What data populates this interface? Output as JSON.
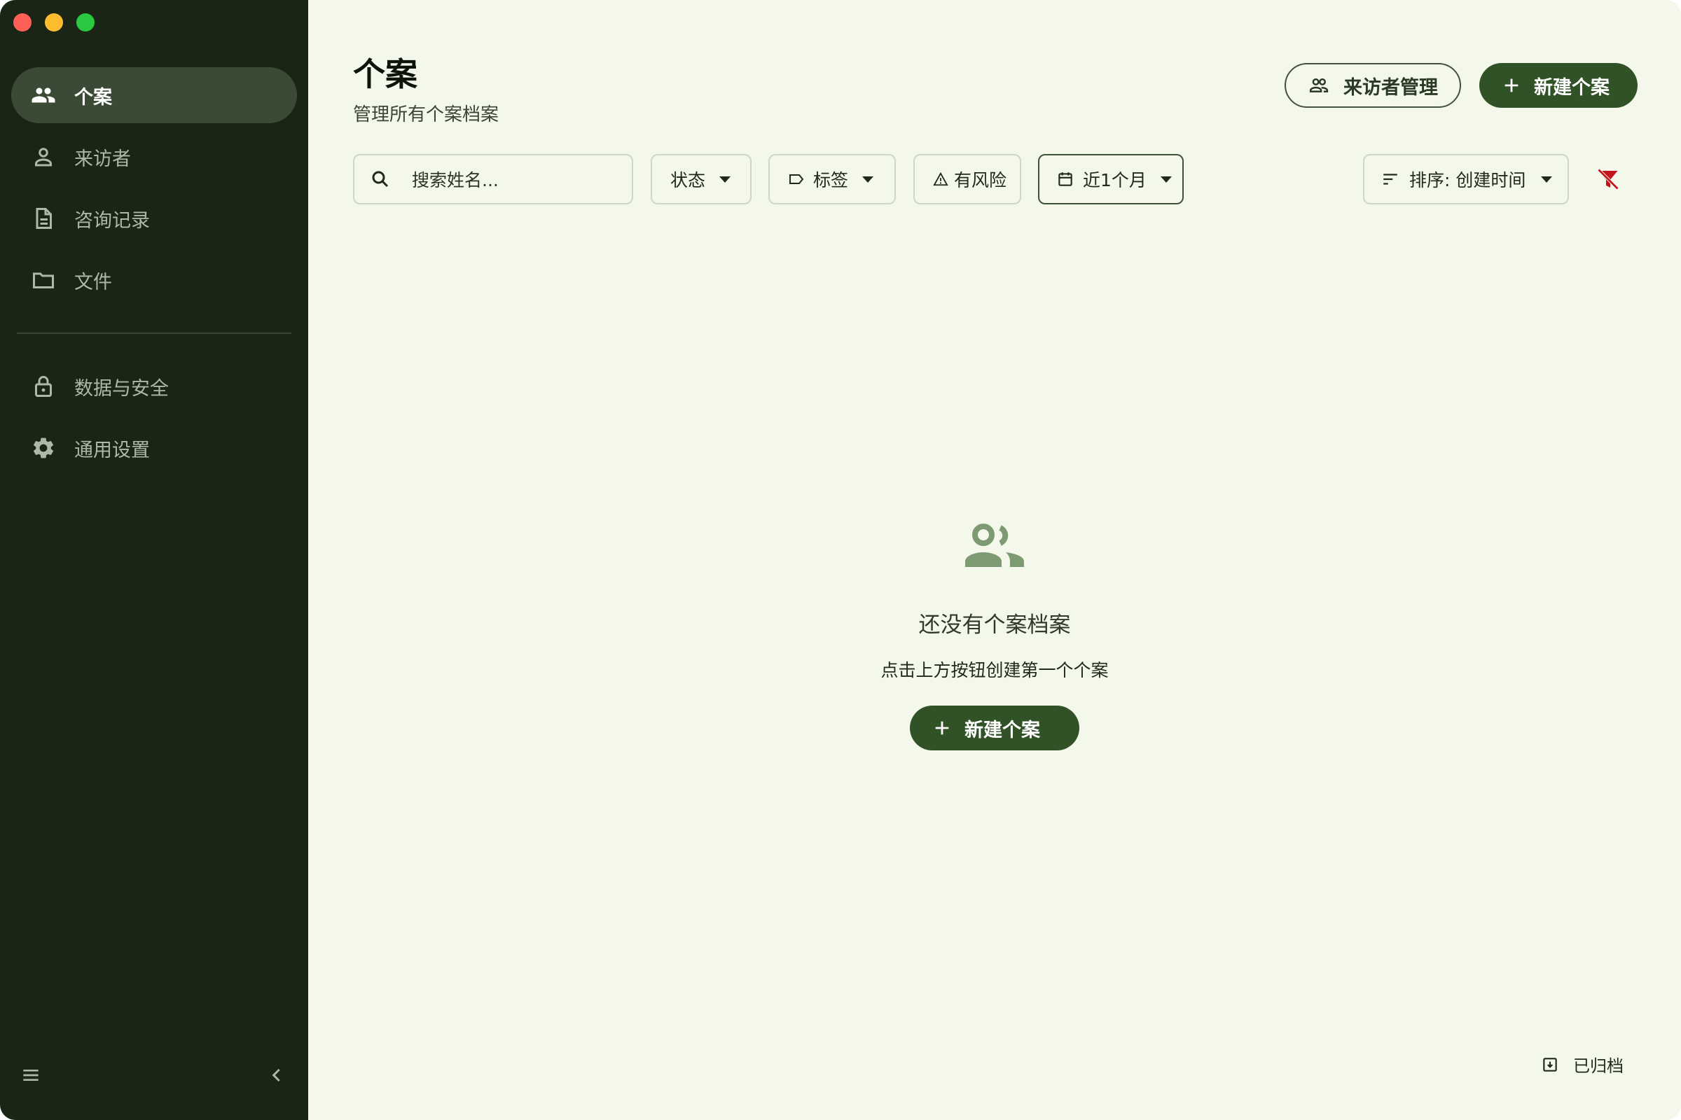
{
  "sidebar": {
    "items": [
      {
        "label": "个案",
        "icon": "people-icon",
        "active": true
      },
      {
        "label": "来访者",
        "icon": "person-icon",
        "active": false
      },
      {
        "label": "咨询记录",
        "icon": "document-icon",
        "active": false
      },
      {
        "label": "文件",
        "icon": "folder-icon",
        "active": false
      }
    ],
    "items2": [
      {
        "label": "数据与安全",
        "icon": "lock-icon"
      },
      {
        "label": "通用设置",
        "icon": "gear-icon"
      }
    ]
  },
  "header": {
    "title": "个案",
    "subtitle": "管理所有个案档案",
    "visitor_btn": "来访者管理",
    "new_btn": "新建个案"
  },
  "filters": {
    "search_placeholder": "搜索姓名...",
    "status": "状态",
    "tags": "标签",
    "risk": "有风险",
    "date": "近1个月",
    "sort": "排序: 创建时间"
  },
  "empty": {
    "title": "还没有个案档案",
    "subtitle": "点击上方按钮创建第一个个案",
    "button": "新建个案"
  },
  "footer": {
    "archived": "已归档"
  },
  "colors": {
    "sidebar_bg": "#1b2515",
    "main_bg": "#f4f8ea",
    "primary": "#315127",
    "danger": "#c3141e"
  }
}
